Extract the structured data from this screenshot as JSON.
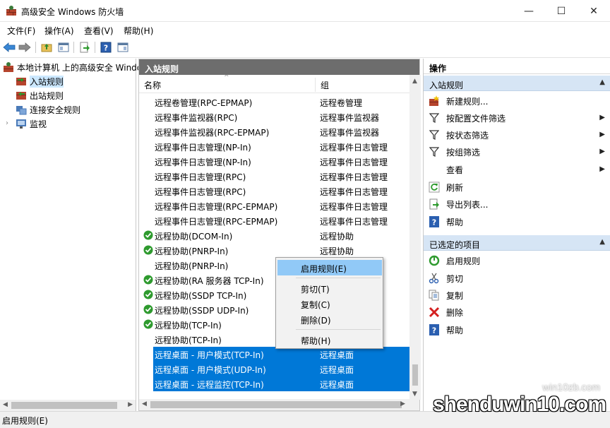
{
  "window": {
    "title": "高级安全 Windows 防火墙",
    "min_glyph": "—",
    "max_glyph": "☐",
    "close_glyph": "✕"
  },
  "menubar": {
    "file": "文件(F)",
    "action": "操作(A)",
    "view": "查看(V)",
    "help": "帮助(H)"
  },
  "tree": {
    "root": "本地计算机 上的高级安全 Windows",
    "items": [
      "入站规则",
      "出站规则",
      "连接安全规则",
      "监视"
    ]
  },
  "rules_pane": {
    "header": "入站规则",
    "col_name": "名称",
    "col_group": "组",
    "rows": [
      {
        "name": "远程卷管理(RPC-EPMAP)",
        "group": "远程卷管理",
        "enabled": false,
        "selected": false
      },
      {
        "name": "远程事件监视器(RPC)",
        "group": "远程事件监视器",
        "enabled": false,
        "selected": false
      },
      {
        "name": "远程事件监视器(RPC-EPMAP)",
        "group": "远程事件监视器",
        "enabled": false,
        "selected": false
      },
      {
        "name": "远程事件日志管理(NP-In)",
        "group": "远程事件日志管理",
        "enabled": false,
        "selected": false
      },
      {
        "name": "远程事件日志管理(NP-In)",
        "group": "远程事件日志管理",
        "enabled": false,
        "selected": false
      },
      {
        "name": "远程事件日志管理(RPC)",
        "group": "远程事件日志管理",
        "enabled": false,
        "selected": false
      },
      {
        "name": "远程事件日志管理(RPC)",
        "group": "远程事件日志管理",
        "enabled": false,
        "selected": false
      },
      {
        "name": "远程事件日志管理(RPC-EPMAP)",
        "group": "远程事件日志管理",
        "enabled": false,
        "selected": false
      },
      {
        "name": "远程事件日志管理(RPC-EPMAP)",
        "group": "远程事件日志管理",
        "enabled": false,
        "selected": false
      },
      {
        "name": "远程协助(DCOM-In)",
        "group": "远程协助",
        "enabled": true,
        "selected": false
      },
      {
        "name": "远程协助(PNRP-In)",
        "group": "远程协助",
        "enabled": true,
        "selected": false
      },
      {
        "name": "远程协助(PNRP-In)",
        "group": "",
        "enabled": false,
        "selected": false
      },
      {
        "name": "远程协助(RA 服务器 TCP-In)",
        "group": "",
        "enabled": true,
        "selected": false
      },
      {
        "name": "远程协助(SSDP TCP-In)",
        "group": "",
        "enabled": true,
        "selected": false
      },
      {
        "name": "远程协助(SSDP UDP-In)",
        "group": "",
        "enabled": true,
        "selected": false
      },
      {
        "name": "远程协助(TCP-In)",
        "group": "",
        "enabled": true,
        "selected": false
      },
      {
        "name": "远程协助(TCP-In)",
        "group": "",
        "enabled": false,
        "selected": false
      },
      {
        "name": "远程桌面 - 用户模式(TCP-In)",
        "group": "远程桌面",
        "enabled": false,
        "selected": true
      },
      {
        "name": "远程桌面 - 用户模式(UDP-In)",
        "group": "远程桌面",
        "enabled": false,
        "selected": true
      },
      {
        "name": "远程桌面 - 远程监控(TCP-In)",
        "group": "远程桌面",
        "enabled": false,
        "selected": true
      }
    ]
  },
  "context_menu": {
    "enable_rule": "启用规则(E)",
    "cut": "剪切(T)",
    "copy": "复制(C)",
    "delete": "删除(D)",
    "help": "帮助(H)"
  },
  "actions_pane": {
    "header": "操作",
    "section1": "入站规则",
    "new_rule": "新建规则...",
    "filter_profile": "按配置文件筛选",
    "filter_state": "按状态筛选",
    "filter_group": "按组筛选",
    "view": "查看",
    "refresh": "刷新",
    "export_list": "导出列表...",
    "help1": "帮助",
    "section2": "已选定的项目",
    "enable_rule": "启用规则",
    "cut": "剪切",
    "copy": "复制",
    "delete": "删除",
    "help2": "帮助"
  },
  "statusbar": {
    "text": "启用规则(E)"
  },
  "watermark": {
    "main": "shenduwin10.com",
    "sub": "win10zb.com"
  },
  "colors": {
    "selection": "#0078d7",
    "menu_highlight": "#91c9f7",
    "section_header": "#d6e5f5",
    "pane_header_dark": "#6d6d6d",
    "check_green": "#2e9a2e"
  }
}
